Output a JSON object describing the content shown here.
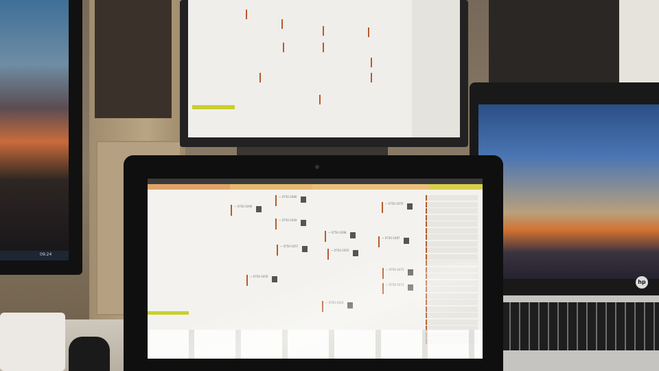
{
  "scene": {
    "left_monitor_clock": "09:24",
    "laptop_brand_logo": "hp"
  },
  "main_app": {
    "window_title": "",
    "tabs": [
      "",
      "",
      "",
      ""
    ],
    "tab_colors": [
      "#e0a468",
      "#e7b86f",
      "#e9c07a",
      "#d6d04a"
    ],
    "side_panel_rows": [
      "",
      "",
      "",
      "",
      "",
      ""
    ],
    "cards": [
      {
        "id": "1",
        "label": "~ 0750-1090"
      },
      {
        "id": "2",
        "label": "~ 0750-1080"
      },
      {
        "id": "3",
        "label": "~ 0750-1049"
      },
      {
        "id": "4",
        "label": "~ 0750-1070"
      },
      {
        "id": "5",
        "label": "~ 0750-1098"
      },
      {
        "id": "6",
        "label": "~ 0750-1087"
      },
      {
        "id": "7",
        "label": "~ 0750-1057"
      },
      {
        "id": "8",
        "label": "~ 0750-1055"
      },
      {
        "id": "9",
        "label": "~ 0750-1075"
      },
      {
        "id": "10",
        "label": "~ 0750-1072"
      },
      {
        "id": "11",
        "label": "~ 0750-1050"
      },
      {
        "id": "12",
        "label": "~ 0750-1024"
      }
    ],
    "right_list_rows": [
      "",
      "",
      "",
      "",
      "",
      "",
      "",
      "",
      "",
      "",
      "",
      "",
      "",
      "",
      "",
      "",
      "",
      "",
      "",
      "",
      "",
      "",
      ""
    ],
    "footer_text": ""
  }
}
